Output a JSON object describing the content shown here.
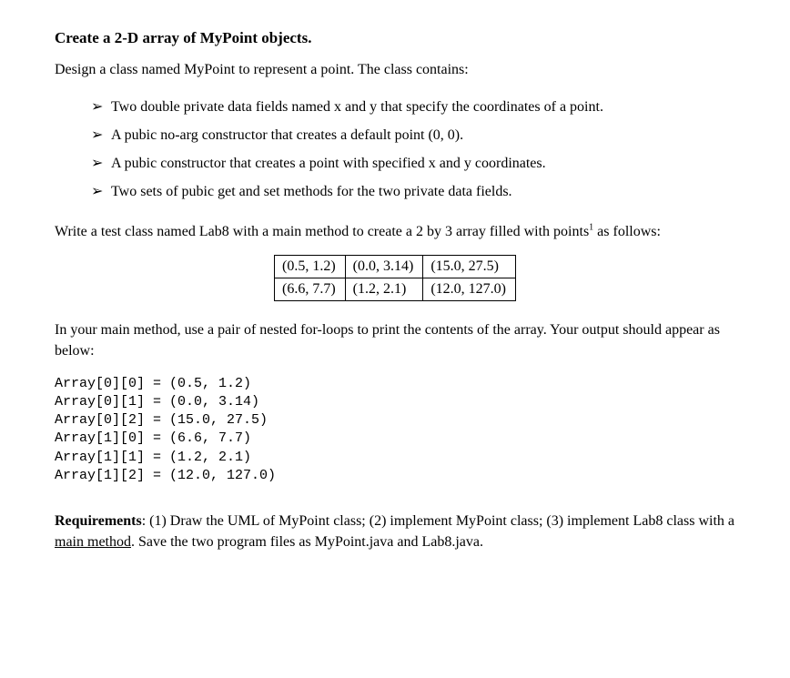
{
  "title": "Create a 2-D array of MyPoint objects.",
  "intro": "Design a class named MyPoint to represent a point.  The class contains:",
  "bullets": [
    "Two double private data fields named x and y that specify the coordinates of a point.",
    "A pubic no-arg constructor that creates a default point (0, 0).",
    "A pubic constructor that creates a point with specified x and y coordinates.",
    "Two sets of pubic get and set methods for the two private data fields."
  ],
  "para1_a": "Write a test class named Lab8 with a main method to create a 2 by 3 array filled with points",
  "para1_sup": "1",
  "para1_b": " as follows:",
  "table": {
    "rows": [
      [
        "(0.5, 1.2)",
        "(0.0, 3.14)",
        "(15.0, 27.5)"
      ],
      [
        "(6.6, 7.7)",
        "(1.2, 2.1)",
        "(12.0, 127.0)"
      ]
    ]
  },
  "para2": "In your main method, use a pair of nested for-loops to print the contents of the array. Your output should appear as below:",
  "output_lines": [
    "Array[0][0] = (0.5, 1.2)",
    "Array[0][1] = (0.0, 3.14)",
    "Array[0][2] = (15.0, 27.5)",
    "Array[1][0] = (6.6, 7.7)",
    "Array[1][1] = (1.2, 2.1)",
    "Array[1][2] = (12.0, 127.0)"
  ],
  "req_label": "Requirements",
  "req_a": ": (1) Draw the UML of MyPoint class; (2) implement MyPoint class; (3) implement Lab8 class with a ",
  "req_u": "main method",
  "req_b": ".  Save the two program files as MyPoint.java and Lab8.java."
}
